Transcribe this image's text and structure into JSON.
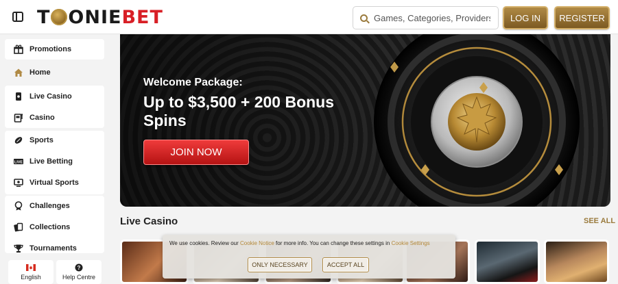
{
  "header": {
    "logo": {
      "part_a": "T",
      "part_b": "ONIE",
      "part_c": "BET"
    },
    "search_placeholder": "Games, Categories, Providers",
    "login_label": "LOG IN",
    "register_label": "REGISTER"
  },
  "sidebar": {
    "items": [
      {
        "label": "Promotions",
        "icon": "gift-icon"
      },
      {
        "label": "Home",
        "icon": "home-icon"
      },
      {
        "label": "Live Casino",
        "icon": "live-casino-icon"
      },
      {
        "label": "Casino",
        "icon": "slot-machine-icon"
      },
      {
        "label": "Sports",
        "icon": "football-icon"
      },
      {
        "label": "Live Betting",
        "icon": "live-badge-icon"
      },
      {
        "label": "Virtual Sports",
        "icon": "monitor-icon"
      },
      {
        "label": "Challenges",
        "icon": "trophy-badge-icon"
      },
      {
        "label": "Collections",
        "icon": "cards-icon"
      },
      {
        "label": "Tournaments",
        "icon": "trophy-icon"
      }
    ],
    "language_label": "English",
    "help_label": "Help Centre"
  },
  "hero": {
    "subtitle": "Welcome Package:",
    "title": "Up to $3,500 + 200 Bonus Spins",
    "cta_label": "JOIN NOW"
  },
  "live_casino": {
    "title": "Live Casino",
    "see_all_label": "SEE ALL"
  },
  "cookie_banner": {
    "text_1": "We use cookies. Review our ",
    "link_1": "Cookie Notice",
    "text_2": " for more info. You can change these settings in ",
    "link_2": "Cookie Settings",
    "only_necessary_label": "ONLY NECESSARY",
    "accept_all_label": "ACCEPT ALL"
  },
  "colors": {
    "gold": "#9a7a3c",
    "brand_red": "#d81f26",
    "cta_red": "#d62626"
  }
}
